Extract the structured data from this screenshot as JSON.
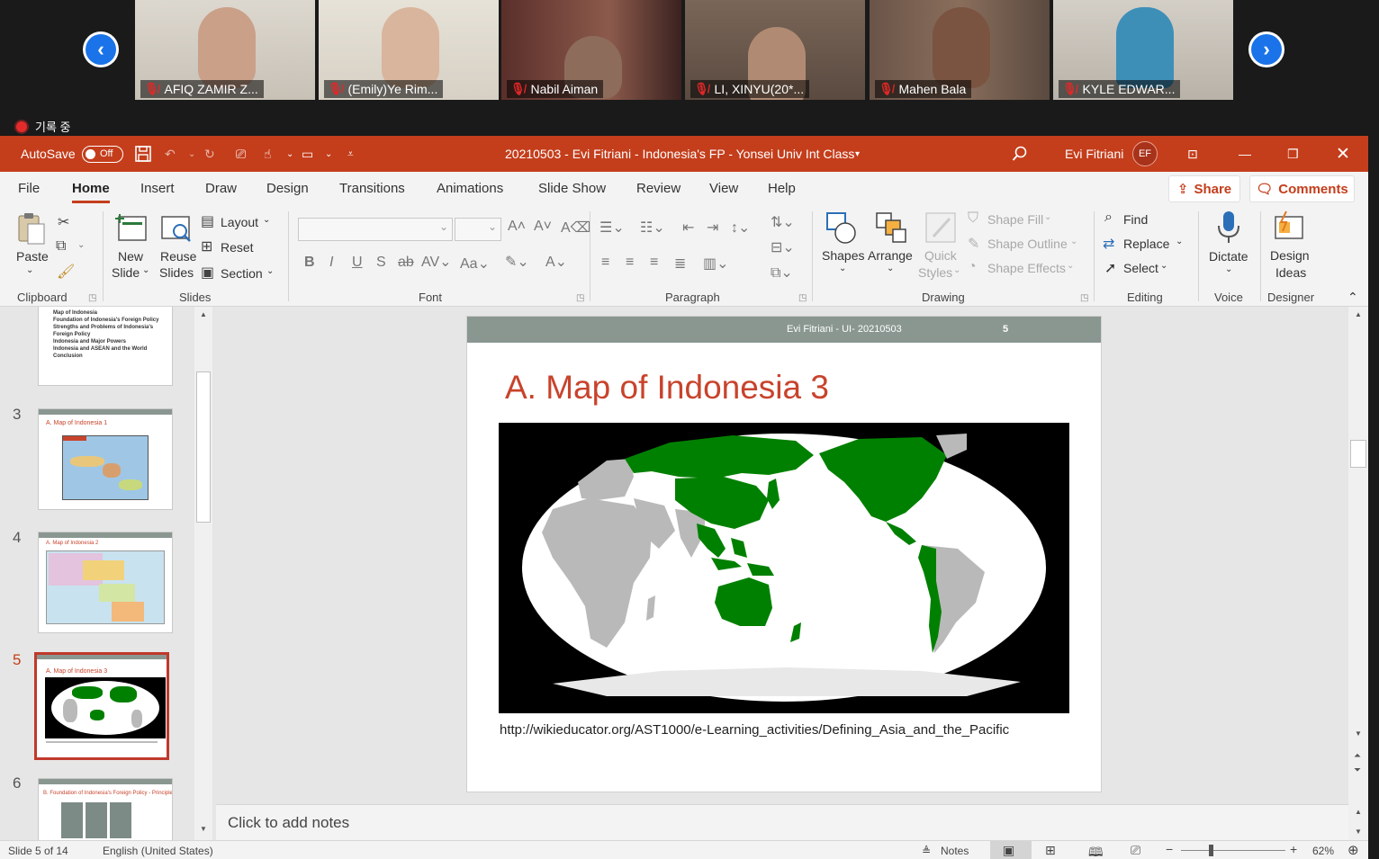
{
  "zoom": {
    "participants": [
      {
        "name": "AFIQ ZAMIR Z..."
      },
      {
        "name": "(Emily)Ye Rim..."
      },
      {
        "name": "Nabil Aiman"
      },
      {
        "name": "LI, XINYU(20*..."
      },
      {
        "name": "Mahen Bala"
      },
      {
        "name": "KYLE EDWAR..."
      }
    ],
    "recording_label": "기록 중"
  },
  "titlebar": {
    "autosave_label": "AutoSave",
    "autosave_state": "Off",
    "document_title": "20210503 - Evi Fitriani - Indonesia's FP - Yonsei Univ Int Class",
    "user_name": "Evi Fitriani",
    "user_initials": "EF"
  },
  "tabs": [
    "File",
    "Home",
    "Insert",
    "Draw",
    "Design",
    "Transitions",
    "Animations",
    "Slide Show",
    "Review",
    "View",
    "Help"
  ],
  "share_label": "Share",
  "comments_label": "Comments",
  "ribbon": {
    "clipboard": {
      "paste": "Paste",
      "label": "Clipboard"
    },
    "slides": {
      "new_slide_1": "New",
      "new_slide_2": "Slide",
      "reuse_1": "Reuse",
      "reuse_2": "Slides",
      "layout": "Layout",
      "reset": "Reset",
      "section": "Section",
      "label": "Slides"
    },
    "font": {
      "label": "Font"
    },
    "paragraph": {
      "label": "Paragraph"
    },
    "drawing": {
      "shapes": "Shapes",
      "arrange": "Arrange",
      "quick_1": "Quick",
      "quick_2": "Styles",
      "shape_fill": "Shape Fill",
      "shape_outline": "Shape Outline",
      "shape_effects": "Shape Effects",
      "label": "Drawing"
    },
    "editing": {
      "find": "Find",
      "replace": "Replace",
      "select": "Select",
      "label": "Editing"
    },
    "voice": {
      "dictate": "Dictate",
      "label": "Voice"
    },
    "designer": {
      "ideas_1": "Design",
      "ideas_2": "Ideas",
      "label": "Designer"
    }
  },
  "thumbnails": {
    "slide2_items": [
      "Map of Indonesia",
      "Foundation of Indonesia's Foreign Policy",
      "Strengths and Problems of Indonesia's Foreign Policy",
      "Indonesia and Major Powers",
      "Indonesia and ASEAN and the World",
      "Conclusion"
    ],
    "slide3_num": "3",
    "slide3_title": "A. Map of Indonesia 1",
    "slide4_num": "4",
    "slide4_title": "A. Map of Indonesia 2",
    "slide5_num": "5",
    "slide5_title": "A. Map of Indonesia 3",
    "slide6_num": "6",
    "slide6_title": "B. Foundation of Indonesia's Foreign Policy - Principle"
  },
  "slide": {
    "header_text": "Evi Fitriani - UI- 20210503",
    "page_number": "5",
    "title": "A. Map of Indonesia 3",
    "url": "http://wikieducator.org/AST1000/e-Learning_activities/Defining_Asia_and_the_Pacific"
  },
  "notes_placeholder": "Click to add notes",
  "status": {
    "slide_count": "Slide 5 of 14",
    "language": "English (United States)",
    "notes": "Notes",
    "zoom": "62%"
  },
  "colors": {
    "accent": "#c43e1c",
    "zoom_blue": "#1a73e8",
    "map_green": "#008000",
    "map_gray": "#b9b9b9"
  }
}
